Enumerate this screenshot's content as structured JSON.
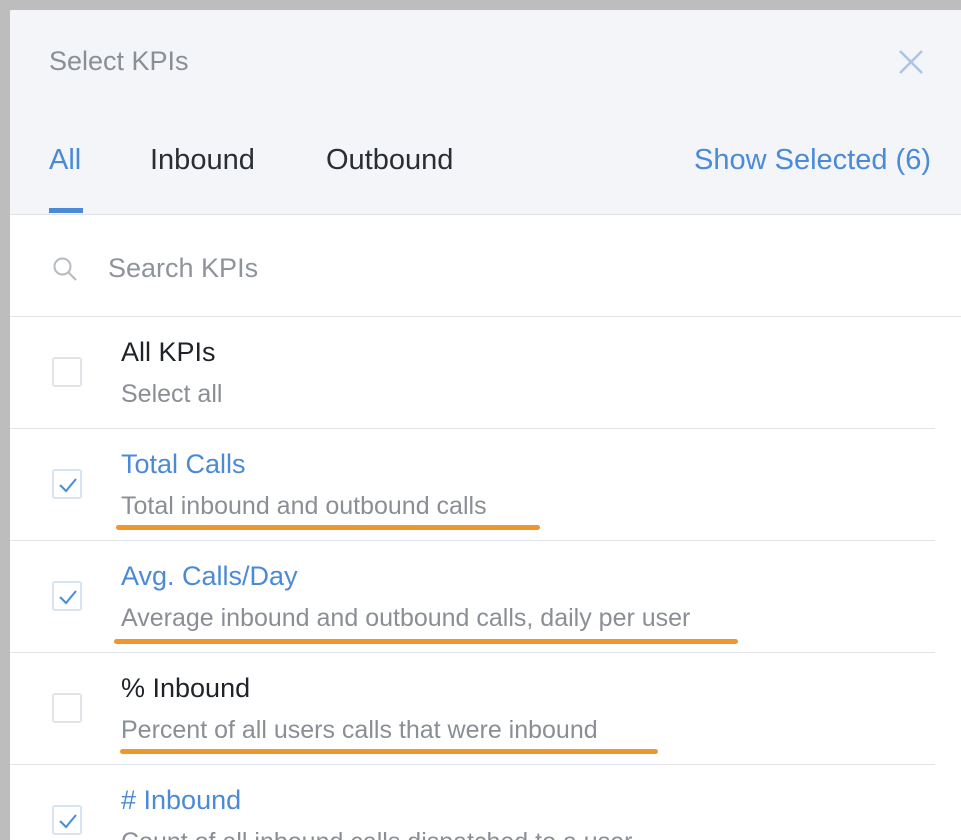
{
  "dialog": {
    "title": "Select KPIs",
    "close_icon": "close-icon"
  },
  "tabs": [
    {
      "label": "All",
      "active": true
    },
    {
      "label": "Inbound",
      "active": false
    },
    {
      "label": "Outbound",
      "active": false
    }
  ],
  "show_selected_label": "Show Selected (6)",
  "search": {
    "placeholder": "Search KPIs",
    "value": "",
    "icon": "search-icon"
  },
  "kpis": [
    {
      "name": "All KPIs",
      "description": "Select all",
      "checked": false
    },
    {
      "name": "Total Calls",
      "description": "Total inbound and outbound calls",
      "checked": true,
      "underlined": true
    },
    {
      "name": "Avg. Calls/Day",
      "description": "Average inbound and outbound calls, daily per user",
      "checked": true,
      "underlined": true
    },
    {
      "name": "% Inbound",
      "description": "Percent of all users calls that were inbound",
      "checked": false,
      "underlined": true
    },
    {
      "name": "# Inbound",
      "description": "Count of all inbound calls dispatched to a user",
      "checked": true
    }
  ],
  "colors": {
    "accent": "#4a8ad6",
    "header_bg": "#f3f5f8",
    "annotation_underline": "#f0962e",
    "muted_text": "#8a8f96"
  }
}
